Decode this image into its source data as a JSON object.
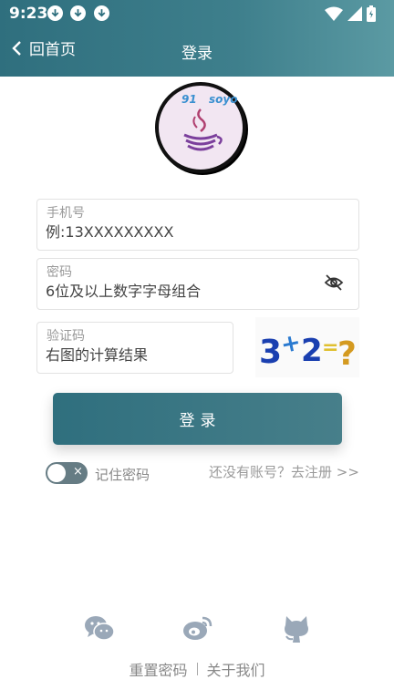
{
  "status_bar": {
    "time": "9:23"
  },
  "nav": {
    "back_label": "回首页",
    "title": "登录"
  },
  "logo": {
    "text_left": "91",
    "text_right": "soyo"
  },
  "form": {
    "phone": {
      "label": "手机号",
      "placeholder": "例:13XXXXXXXXX"
    },
    "password": {
      "label": "密码",
      "placeholder": "6位及以上数字字母组合"
    },
    "captcha": {
      "label": "验证码",
      "placeholder": "右图的计算结果",
      "image_text": [
        "3",
        "+",
        "2",
        "=",
        "?"
      ]
    }
  },
  "login_button": {
    "label": "登录"
  },
  "remember": {
    "label": "记住密码",
    "toggle_mark": "×",
    "checked": false
  },
  "register": {
    "label": "还没有账号？去注册 >>"
  },
  "social": {
    "icons": [
      "wechat-icon",
      "weibo-icon",
      "github-icon"
    ]
  },
  "footer": {
    "reset_label": "重置密码",
    "about_label": "关于我们"
  },
  "colors": {
    "accent": "#2f6f7e",
    "icon_gray": "#9aa8b8"
  }
}
